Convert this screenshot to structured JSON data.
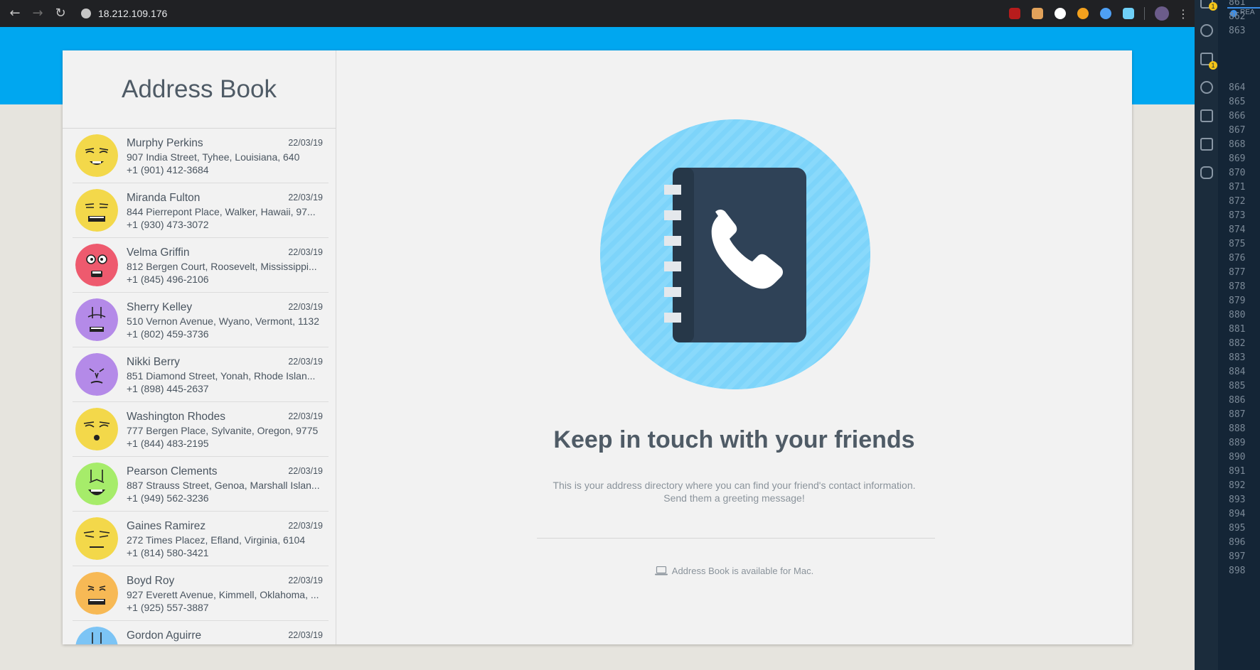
{
  "browser": {
    "back_label": "←",
    "forward_label": "→",
    "reload_label": "↻",
    "url": "18.212.109.176",
    "menu_label": "⋮",
    "extension_colors": [
      "#b71c1c",
      "#e2a25a",
      "#ffffff",
      "#f4a11d",
      "#4ea0f5",
      "#6fd0f7"
    ]
  },
  "app": {
    "title": "Address Book",
    "contacts": [
      {
        "name": "Murphy Perkins",
        "address": "907 India Street, Tyhee, Louisiana, 640",
        "phone": "+1 (901) 412-3684",
        "date": "22/03/19",
        "color": "#f3d84a"
      },
      {
        "name": "Miranda Fulton",
        "address": "844 Pierrepont Place, Walker, Hawaii, 97...",
        "phone": "+1 (930) 473-3072",
        "date": "22/03/19",
        "color": "#f3d84a"
      },
      {
        "name": "Velma Griffin",
        "address": "812 Bergen Court, Roosevelt, Mississippi...",
        "phone": "+1 (845) 496-2106",
        "date": "22/03/19",
        "color": "#ee5a6e"
      },
      {
        "name": "Sherry Kelley",
        "address": "510 Vernon Avenue, Wyano, Vermont, 1132",
        "phone": "+1 (802) 459-3736",
        "date": "22/03/19",
        "color": "#b48ae8"
      },
      {
        "name": "Nikki Berry",
        "address": "851 Diamond Street, Yonah, Rhode Islan...",
        "phone": "+1 (898) 445-2637",
        "date": "22/03/19",
        "color": "#b48ae8"
      },
      {
        "name": "Washington Rhodes",
        "address": "777 Bergen Place, Sylvanite, Oregon, 9775",
        "phone": "+1 (844) 483-2195",
        "date": "22/03/19",
        "color": "#f3d84a"
      },
      {
        "name": "Pearson Clements",
        "address": "887 Strauss Street, Genoa, Marshall Islan...",
        "phone": "+1 (949) 562-3236",
        "date": "22/03/19",
        "color": "#a6ec6a"
      },
      {
        "name": "Gaines Ramirez",
        "address": "272 Times Placez, Efland, Virginia, 6104",
        "phone": "+1 (814) 580-3421",
        "date": "22/03/19",
        "color": "#f3d84a"
      },
      {
        "name": "Boyd Roy",
        "address": "927 Everett Avenue, Kimmell, Oklahoma, ...",
        "phone": "+1 (925) 557-3887",
        "date": "22/03/19",
        "color": "#f7b955"
      },
      {
        "name": "Gordon Aguirre",
        "address": "",
        "phone": "",
        "date": "22/03/19",
        "color": "#7cc4f5"
      }
    ],
    "headline": "Keep in touch with your friends",
    "subtext_line1": "This is your address directory where you can find your friend's contact information.",
    "subtext_line2": "Send them a greeting message!",
    "footer_note": "Address Book is available for Mac."
  },
  "editor": {
    "tab_label": "REA",
    "line_numbers": [
      "861",
      "862",
      "863",
      "864",
      "865",
      "866",
      "867",
      "868",
      "869",
      "870",
      "871",
      "872",
      "873",
      "874",
      "875",
      "876",
      "877",
      "878",
      "879",
      "880",
      "881",
      "882",
      "883",
      "884",
      "885",
      "886",
      "887",
      "888",
      "889",
      "890",
      "891",
      "892",
      "893",
      "894",
      "895",
      "896",
      "897",
      "898"
    ],
    "badge_count": "1"
  }
}
